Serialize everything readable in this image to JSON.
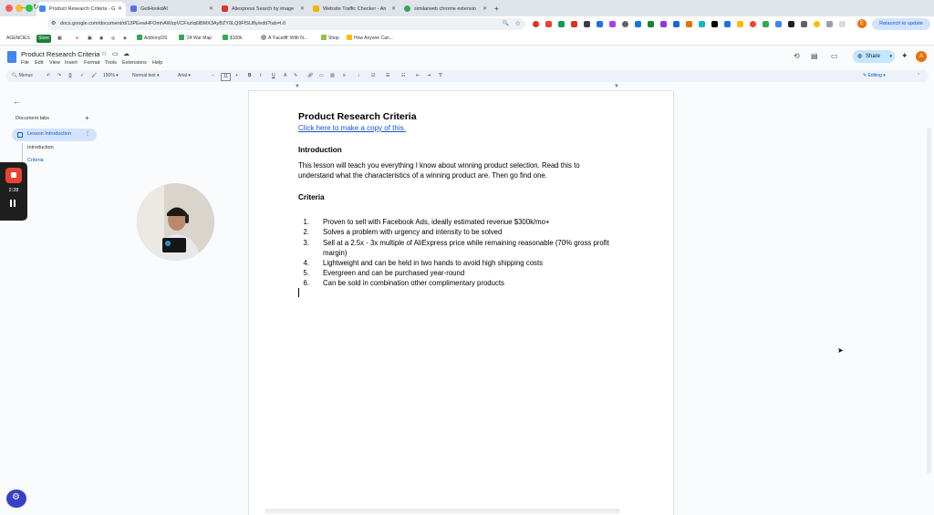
{
  "browser": {
    "tabs": [
      {
        "label": "Product Research Criteria - G",
        "active": true
      },
      {
        "label": "GetHookdAI",
        "active": false
      },
      {
        "label": "Aliexpress Search by image",
        "active": false
      },
      {
        "label": "Website Traffic Checker - An",
        "active": false
      },
      {
        "label": "similarweb chrome extensio",
        "active": false
      }
    ],
    "new_tab": "+",
    "url": "docs.google.com/document/d/13PEewHFOmhAWzpVCFxzIq6lBMX3AyBZY0LQ9FfSU8y/edit?tab=t.0",
    "relaunch_label": "Relaunch to update",
    "profile_initial": "E",
    "bookmarks": [
      "AGENCIES",
      "Store",
      "AnthonyDS",
      "'24 War Map",
      "$100k",
      "A 'Facelift' With N...",
      "Shop",
      "How Anyone Can..."
    ]
  },
  "docs": {
    "title": "Product Research Criteria",
    "menus": [
      "File",
      "Edit",
      "View",
      "Insert",
      "Format",
      "Tools",
      "Extensions",
      "Help"
    ],
    "share_label": "Share",
    "avatar_initial": "A",
    "toolbar": {
      "menus_label": "Menus",
      "zoom": "150%",
      "style": "Normal text",
      "font": "Arial",
      "font_size": "11",
      "mode": "Editing"
    }
  },
  "sidebar": {
    "back_label": "←",
    "tabs_heading": "Document tabs",
    "add_label": "+",
    "active_tab": "Lesson Introduction",
    "outline": [
      "Introduction",
      "Criteria"
    ]
  },
  "recorder": {
    "time": "2:28"
  },
  "document": {
    "title": "Product Research Criteria",
    "link": "Click here to make a copy of this.",
    "intro_heading": "Introduction",
    "intro_text": "This lesson will teach you everything I know about winning product selection. Read this to understand what the characteristics of a winning product are. Then go find one.",
    "criteria_heading": "Criteria",
    "criteria": [
      {
        "n": "1.",
        "text": "Proven to sell with Facebook Ads, ideally estimated revenue $300k/mo+"
      },
      {
        "n": "2.",
        "text": "Solves a problem with urgency and intensity to be solved"
      },
      {
        "n": "3.",
        "text": "Sell at a 2.5x - 3x multiple of AliExpress price while remaining reasonable (70% gross profit margin)"
      },
      {
        "n": "4.",
        "text": "Lightweight and can be held in two hands to avoid high shipping costs"
      },
      {
        "n": "5.",
        "text": "Evergreen and can be purchased year-round"
      },
      {
        "n": "6.",
        "text": "Can be sold in combination other complimentary products"
      }
    ]
  },
  "colors": {
    "accent": "#0b57d0",
    "share_bg": "#c2e7ff",
    "record_red": "#ea4335",
    "link": "#1155cc"
  }
}
